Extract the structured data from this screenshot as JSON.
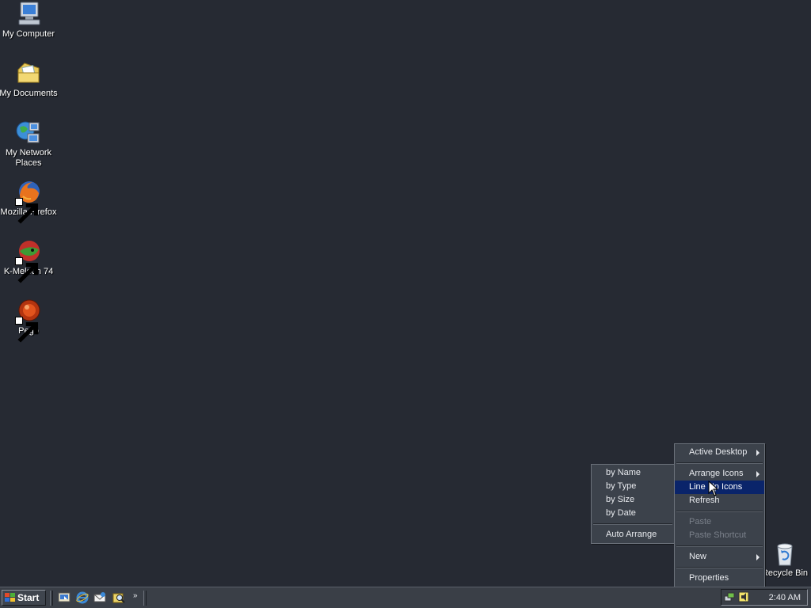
{
  "desktop": {
    "icons": [
      {
        "label": "My Computer",
        "icon": "my-computer-icon"
      },
      {
        "label": "My Documents",
        "icon": "my-documents-icon"
      },
      {
        "label": "My Network Places",
        "icon": "network-places-icon"
      },
      {
        "label": "Mozilla Firefox",
        "icon": "firefox-icon"
      },
      {
        "label": "K-Meleon 74",
        "icon": "k-meleon-icon"
      },
      {
        "label": "Pego",
        "icon": "pego-icon"
      },
      {
        "label": "Recycle Bin",
        "icon": "recycle-bin-icon"
      }
    ]
  },
  "context_menu": {
    "items": {
      "active_desktop": "Active Desktop",
      "arrange_icons": "Arrange Icons",
      "line_up_icons": "Line Up Icons",
      "refresh": "Refresh",
      "paste": "Paste",
      "paste_shortcut": "Paste Shortcut",
      "new": "New",
      "properties": "Properties"
    },
    "highlighted": "Line Up Icons"
  },
  "submenu": {
    "items": {
      "by_name": "by Name",
      "by_type": "by Type",
      "by_size": "by Size",
      "by_date": "by Date",
      "auto_arrange": "Auto Arrange"
    }
  },
  "taskbar": {
    "start_label": "Start",
    "quick_launch": [
      "show-desktop-icon",
      "internet-explorer-icon",
      "outlook-express-icon",
      "search-icon"
    ],
    "overflow_label": "»",
    "clock": "2:40 AM"
  },
  "colors": {
    "desktop_bg": "#262a33",
    "menu_bg": "#3c424b",
    "highlight": "#0a246a",
    "taskbar_bg": "#3a3f47"
  }
}
